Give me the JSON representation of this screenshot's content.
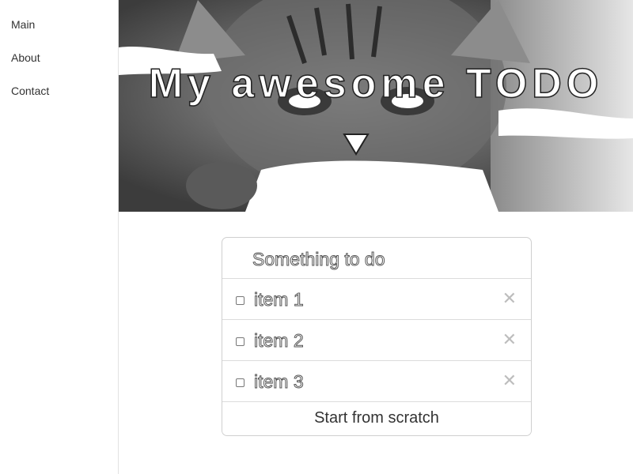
{
  "sidebar": {
    "items": [
      {
        "label": "Main"
      },
      {
        "label": "About"
      },
      {
        "label": "Contact"
      }
    ]
  },
  "hero": {
    "title": "My awesome TODO"
  },
  "todo": {
    "new_placeholder": "Something to do",
    "new_value": "",
    "items": [
      {
        "label": "item 1",
        "checked": false,
        "delete_glyph": "✕"
      },
      {
        "label": "item 2",
        "checked": false,
        "delete_glyph": "✕"
      },
      {
        "label": "item 3",
        "checked": false,
        "delete_glyph": "✕"
      }
    ],
    "reset_label": "Start from scratch"
  },
  "icons": {
    "delete": "close-icon",
    "checkbox": "checkbox-icon"
  },
  "colors": {
    "border": "#cfcfcf",
    "divider": "#dcdcdc",
    "delete": "#bdbdbd",
    "text": "#333333"
  }
}
